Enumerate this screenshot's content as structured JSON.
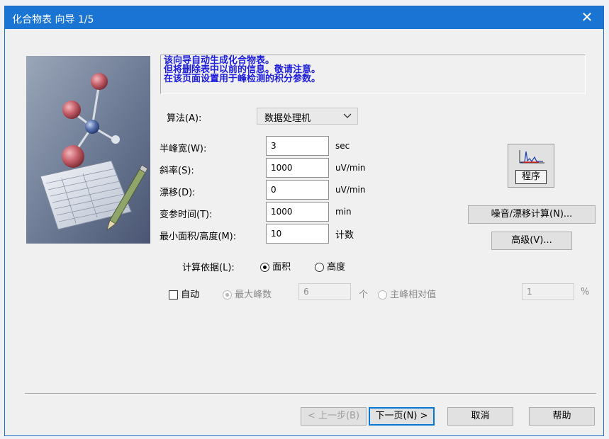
{
  "window": {
    "title": "化合物表 向导 1/5",
    "close_label": "✕"
  },
  "info": {
    "lines": [
      "该向导自动生成化合物表。",
      "但将删除表中以前的信息。敬请注意。",
      "在该页面设置用于峰检测的积分参数。"
    ]
  },
  "algorithm": {
    "label": "算法(A):",
    "selected": "数据处理机"
  },
  "params": {
    "half_width": {
      "label": "半峰宽(W):",
      "value": "3",
      "unit": "sec"
    },
    "slope": {
      "label": "斜率(S):",
      "value": "1000",
      "unit": "uV/min"
    },
    "drift": {
      "label": "漂移(D):",
      "value": "0",
      "unit": "uV/min"
    },
    "t_dbl": {
      "label": "变参时间(T):",
      "value": "1000",
      "unit": "min"
    },
    "min_area": {
      "label": "最小面积/高度(M):",
      "value": "10",
      "unit": "计数"
    }
  },
  "calc_basis": {
    "label": "计算依据(L):",
    "option_area": "面积",
    "option_height": "高度",
    "selected": "area"
  },
  "auto": {
    "checkbox_label": "自动",
    "max_peaks_label": "最大峰数",
    "max_peaks_value": "6",
    "max_peaks_unit": "个",
    "main_peak_label": "主峰相对值",
    "main_peak_value": "1",
    "main_peak_unit": "%"
  },
  "side_buttons": {
    "program": "程序",
    "noise_drift": "噪音/漂移计算(N)...",
    "advanced": "高级(V)..."
  },
  "footer": {
    "back": "< 上一步(B)",
    "next": "下一页(N) >",
    "cancel": "取消",
    "help": "帮助"
  },
  "colors": {
    "titlebar": "#1a74d4",
    "info_text": "#1c1cdc",
    "window_bg": "#f0f0f0"
  }
}
